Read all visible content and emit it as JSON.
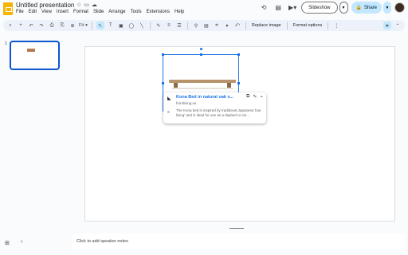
{
  "window": {
    "title": "Untitled presentation"
  },
  "menu": [
    "File",
    "Edit",
    "View",
    "Insert",
    "Format",
    "Slide",
    "Arrange",
    "Tools",
    "Extensions",
    "Help"
  ],
  "header": {
    "slideshow_label": "Slideshow",
    "share_label": "Share"
  },
  "toolbar": {
    "zoom_label": "Fit",
    "replace_image_label": "Replace image",
    "format_options_label": "Format options"
  },
  "filmstrip": {
    "slide_number": "1"
  },
  "link_popup": {
    "title": "Kona Bed in natural oak v...",
    "url": "formliving.us",
    "description": "The Kona bed is inspired by traditional Japanese 'low living' and is ideal for use as a daybed or sin..."
  },
  "notes": {
    "placeholder": "Click to add speaker notes"
  },
  "colors": {
    "accent": "#0b57d0",
    "share_bg": "#c2e7ff",
    "logo": "#f4b400",
    "link": "#1a73e8"
  },
  "icons": [
    "history-icon",
    "comment-icon",
    "video-icon",
    "search-icon",
    "undo-icon",
    "redo-icon",
    "print-icon",
    "paint-format-icon",
    "zoom-icon",
    "cursor-icon",
    "textbox-icon",
    "image-icon",
    "shapes-icon",
    "line-icon",
    "pen-icon",
    "border-weight-icon",
    "border-dash-icon",
    "link-icon",
    "crop-icon",
    "copy-link-icon",
    "edit-icon",
    "unlink-icon",
    "grid-view-icon",
    "collapse-icon"
  ]
}
